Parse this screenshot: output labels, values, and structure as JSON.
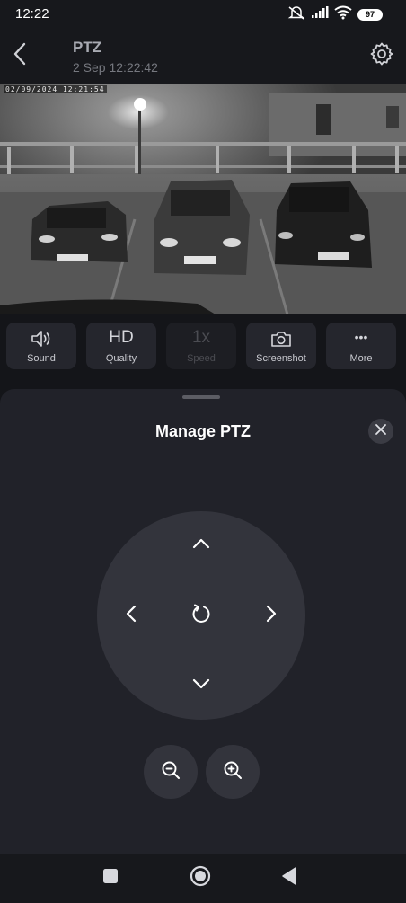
{
  "status_bar": {
    "time": "12:22",
    "battery": "97",
    "icons": [
      "mute-vibrate-icon",
      "signal-icon",
      "wifi-icon",
      "battery-icon"
    ]
  },
  "header": {
    "title": "PTZ",
    "subtitle": "2 Sep 12:22:42",
    "back_icon": "chevron-left-icon",
    "settings_icon": "gear-icon"
  },
  "video": {
    "timestamp": "02/09/2024  12:21:54"
  },
  "controls": [
    {
      "icon": "speaker-icon",
      "label": "Sound",
      "enabled": true
    },
    {
      "icon_text": "HD",
      "label": "Quality",
      "enabled": true
    },
    {
      "icon_text": "1x",
      "label": "Speed",
      "enabled": false
    },
    {
      "icon": "camera-icon",
      "label": "Screenshot",
      "enabled": true
    },
    {
      "icon_text": "•••",
      "label": "More",
      "enabled": true
    }
  ],
  "sheet": {
    "title": "Manage PTZ",
    "close_icon": "close-icon",
    "joystick": [
      "up-arrow-icon",
      "left-arrow-icon",
      "reset-icon",
      "right-arrow-icon",
      "down-arrow-icon"
    ],
    "zoom": [
      "zoom-out-icon",
      "zoom-in-icon"
    ]
  },
  "navbar": [
    "recents-icon",
    "home-icon",
    "back-icon"
  ],
  "colors": {
    "background": "#141519",
    "sheet": "#212229",
    "button": "#25262d",
    "joystick": "#33343c"
  }
}
